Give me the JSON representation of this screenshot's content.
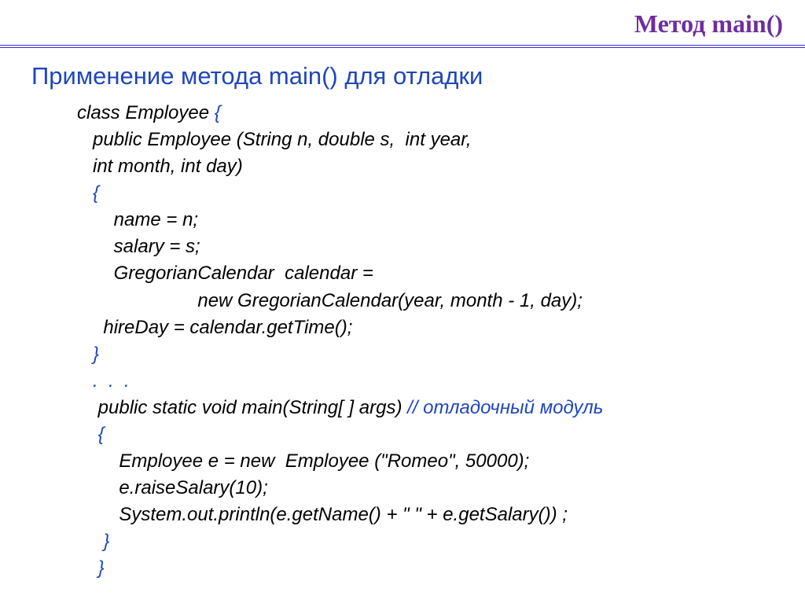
{
  "header": {
    "title": "Метод main()"
  },
  "section": {
    "title": "Применение метода main() для отладки"
  },
  "code": {
    "l1": "class Employee",
    "l1b": " {",
    "l2": "   public Employee (String n, double s,  int year,",
    "l3": "   int month, int day)",
    "l4": "   {",
    "l5": "       name = n;",
    "l6": "       salary = s;",
    "l7": "       GregorianCalendar  calendar =",
    "l8": "                       new GregorianCalendar(year, month - 1, day);",
    "l9": "     hireDay = calendar.getTime();",
    "l10": "   }",
    "l11": "   .  .  .",
    "l12a": "    public static void main(String[ ] args) ",
    "l12b": "// отладочный модуль",
    "l13": "    {",
    "l14": "        Employee e = new  Employee (\"Romeo\", 50000);",
    "l15": "        e.raiseSalary(10);",
    "l16": "        System.out.println(e.getName() + \" \" + e.getSalary()) ;",
    "l17": "     }",
    "l18": "    }"
  }
}
